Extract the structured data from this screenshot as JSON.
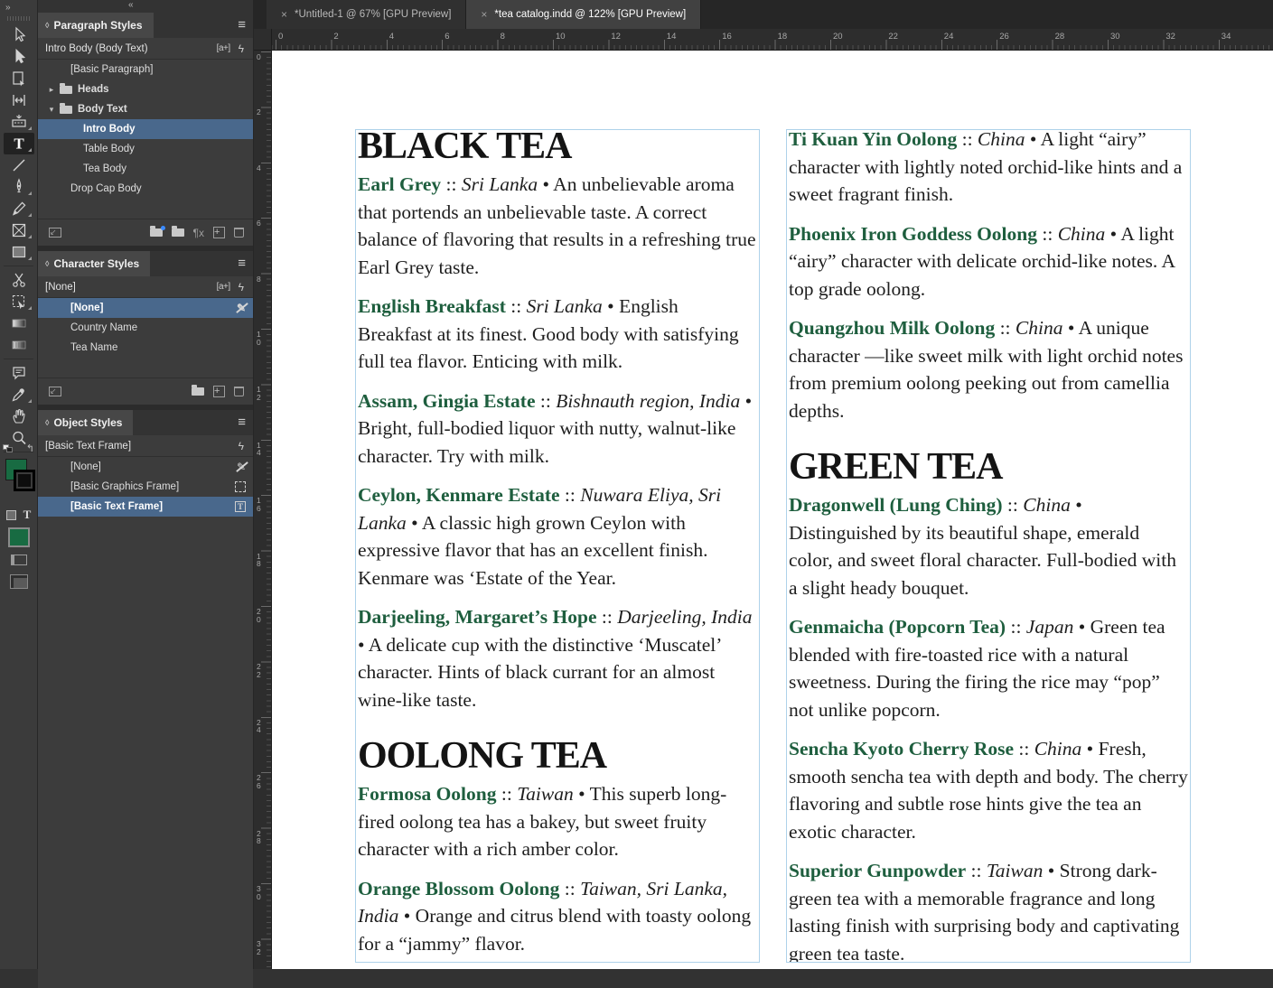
{
  "colors": {
    "tea_name_green": "#1e5e3e",
    "swatch_green": "#186b42",
    "selection_blue": "#49688c",
    "frame_edge_blue": "#aed2ea"
  },
  "icons": {
    "toolbar_expand": "»",
    "dock_collapse": "«",
    "panel_diamond": "◊",
    "panel_menu": "≡",
    "style_override_badge": "[a+]",
    "lightning": "ϟ",
    "caret_collapsed": "▸",
    "caret_expanded": "▾",
    "tab_close": "×",
    "clear_overrides": "¶x",
    "load_arrow": "↙",
    "plus": "+",
    "no_style": "✎",
    "swap_arrow": "↰"
  },
  "window": {
    "tabs": [
      {
        "label": "*Untitled-1 @ 67% [GPU Preview]",
        "active": false
      },
      {
        "label": "*tea catalog.indd @ 122% [GPU Preview]",
        "active": true
      }
    ]
  },
  "toolbar": {
    "tools": [
      {
        "name": "selection-tool",
        "flyout": false
      },
      {
        "name": "direct-selection-tool",
        "flyout": false
      },
      {
        "name": "page-tool",
        "flyout": false
      },
      {
        "name": "gap-tool",
        "flyout": false
      },
      {
        "name": "content-collector-tool",
        "flyout": true
      },
      {
        "name": "type-tool",
        "flyout": true,
        "selected": true
      },
      {
        "name": "line-tool",
        "flyout": false
      },
      {
        "name": "pen-tool",
        "flyout": true
      },
      {
        "name": "pencil-tool",
        "flyout": true
      },
      {
        "name": "frame-tool",
        "flyout": true
      },
      {
        "name": "rectangle-tool",
        "flyout": true
      },
      {
        "name": "scissors-tool",
        "flyout": false
      },
      {
        "name": "free-transform-tool",
        "flyout": true
      },
      {
        "name": "gradient-tool",
        "flyout": false
      },
      {
        "name": "gradient-feather-tool",
        "flyout": false
      },
      {
        "name": "note-tool",
        "flyout": false
      },
      {
        "name": "eyedropper-tool",
        "flyout": true
      },
      {
        "name": "hand-tool",
        "flyout": false
      },
      {
        "name": "zoom-tool",
        "flyout": false
      }
    ]
  },
  "panels": {
    "paragraph_styles": {
      "title": "Paragraph Styles",
      "current": "Intro Body (Body Text)",
      "current_badges": [
        "override",
        "lightning"
      ],
      "rows": [
        {
          "label": "[Basic Paragraph]",
          "indent": 1
        },
        {
          "label": "Heads",
          "folder": true,
          "collapsed": true
        },
        {
          "label": "Body Text",
          "folder": true,
          "collapsed": false
        },
        {
          "label": "Intro Body",
          "indent": 2,
          "selected": true
        },
        {
          "label": "Table Body",
          "indent": 2
        },
        {
          "label": "Tea Body",
          "indent": 2
        },
        {
          "label": "Drop Cap Body",
          "indent": 1
        }
      ]
    },
    "character_styles": {
      "title": "Character Styles",
      "current": "[None]",
      "current_badges": [
        "override",
        "lightning"
      ],
      "rows": [
        {
          "label": "[None]",
          "indent": 1,
          "selected": true,
          "trailing": "no-style"
        },
        {
          "label": "Country Name",
          "indent": 1
        },
        {
          "label": "Tea Name",
          "indent": 1
        }
      ]
    },
    "object_styles": {
      "title": "Object Styles",
      "current": "[Basic Text Frame]",
      "current_badges": [
        "lightning"
      ],
      "rows": [
        {
          "label": "[None]",
          "indent": 1,
          "trailing": "no-style"
        },
        {
          "label": "[Basic Graphics Frame]",
          "indent": 1,
          "trailing": "graphics-frame"
        },
        {
          "label": "[Basic Text Frame]",
          "indent": 1,
          "selected": true,
          "trailing": "text-frame"
        }
      ]
    }
  },
  "rulers": {
    "horizontal": [
      0,
      2,
      4,
      6,
      8,
      10,
      12,
      14,
      16,
      18,
      20,
      22,
      24,
      26,
      28,
      30,
      32,
      34
    ],
    "vertical": [
      0,
      2,
      4,
      6,
      8,
      10,
      12,
      14,
      16,
      18,
      20,
      22,
      24,
      26,
      28,
      30,
      32
    ]
  },
  "document": {
    "separator": "::",
    "bullet": "•",
    "columns": [
      {
        "blocks": [
          {
            "type": "heading",
            "text": "BLACK TEA"
          },
          {
            "type": "entry",
            "name": "Earl Grey",
            "origin": "Sri Lanka",
            "desc": "An unbelievable aroma that portends an unbelievable taste. A correct balance of flavoring that results in a refreshing true Earl Grey taste."
          },
          {
            "type": "entry",
            "name": "English Breakfast",
            "origin": "Sri Lanka",
            "desc": "English Breakfast at its finest. Good body with satisfying full tea flavor. Enticing with milk."
          },
          {
            "type": "entry",
            "name": "Assam, Gingia Estate",
            "origin": "Bishnauth region, India",
            "desc": "Bright, full-bodied liquor with nutty, walnut-like character. Try with milk."
          },
          {
            "type": "entry",
            "name": "Ceylon, Kenmare Estate",
            "origin": "Nuwara Eliya, Sri Lanka",
            "desc": "A classic high grown Ceylon with expressive flavor that has an excellent finish. Kenmare was ‘Estate of the Year."
          },
          {
            "type": "entry",
            "name": "Darjeeling, Margaret’s Hope",
            "origin": "Darjeeling, India",
            "desc": "A delicate cup with the distinctive ‘Muscatel’ character. Hints of black currant for an almost wine-like taste."
          },
          {
            "type": "heading",
            "text": "OOLONG TEA"
          },
          {
            "type": "entry",
            "name": "Formosa Oolong",
            "origin": "Taiwan",
            "desc": "This superb long-fired oolong tea has a bakey, but sweet fruity character with a rich amber color."
          },
          {
            "type": "entry",
            "name": "Orange Blossom Oolong",
            "origin": "Taiwan, Sri Lanka, India",
            "desc": "Orange and citrus blend with toasty oolong for a “jammy” flavor."
          }
        ]
      },
      {
        "blocks": [
          {
            "type": "entry",
            "name": "Ti Kuan Yin Oolong",
            "origin": "China",
            "desc": "A light “airy” character with lightly noted orchid-like hints and a sweet fragrant finish."
          },
          {
            "type": "entry",
            "name": "Phoenix Iron Goddess Oolong",
            "origin": "China",
            "desc": "A light “airy” character with delicate orchid-like notes. A top grade oolong."
          },
          {
            "type": "entry",
            "name": "Quangzhou Milk Oolong",
            "origin": "China",
            "desc": "A unique character —like sweet milk with light orchid notes from premium oolong peeking out from camellia depths."
          },
          {
            "type": "heading",
            "text": "GREEN TEA"
          },
          {
            "type": "entry",
            "name": "Dragonwell (Lung Ching)",
            "origin": "China",
            "desc": "Distinguished by its beautiful shape, emerald color, and sweet floral character. Full-bodied with a slight heady bouquet."
          },
          {
            "type": "entry",
            "name": "Genmaicha (Popcorn Tea)",
            "origin": "Japan",
            "desc": "Green tea blended with fire-toasted rice with a natural sweetness. During the firing the rice may “pop” not unlike popcorn."
          },
          {
            "type": "entry",
            "name": "Sencha Kyoto Cherry Rose",
            "origin": "China",
            "desc": "Fresh, smooth sencha tea with depth and body. The cherry flavoring and subtle rose hints give the tea an exotic character."
          },
          {
            "type": "entry",
            "name": "Superior Gunpowder",
            "origin": "Taiwan",
            "desc": "Strong dark-green tea with a memorable fragrance and long lasting finish with surprising body and captivating green tea taste."
          }
        ]
      }
    ]
  }
}
